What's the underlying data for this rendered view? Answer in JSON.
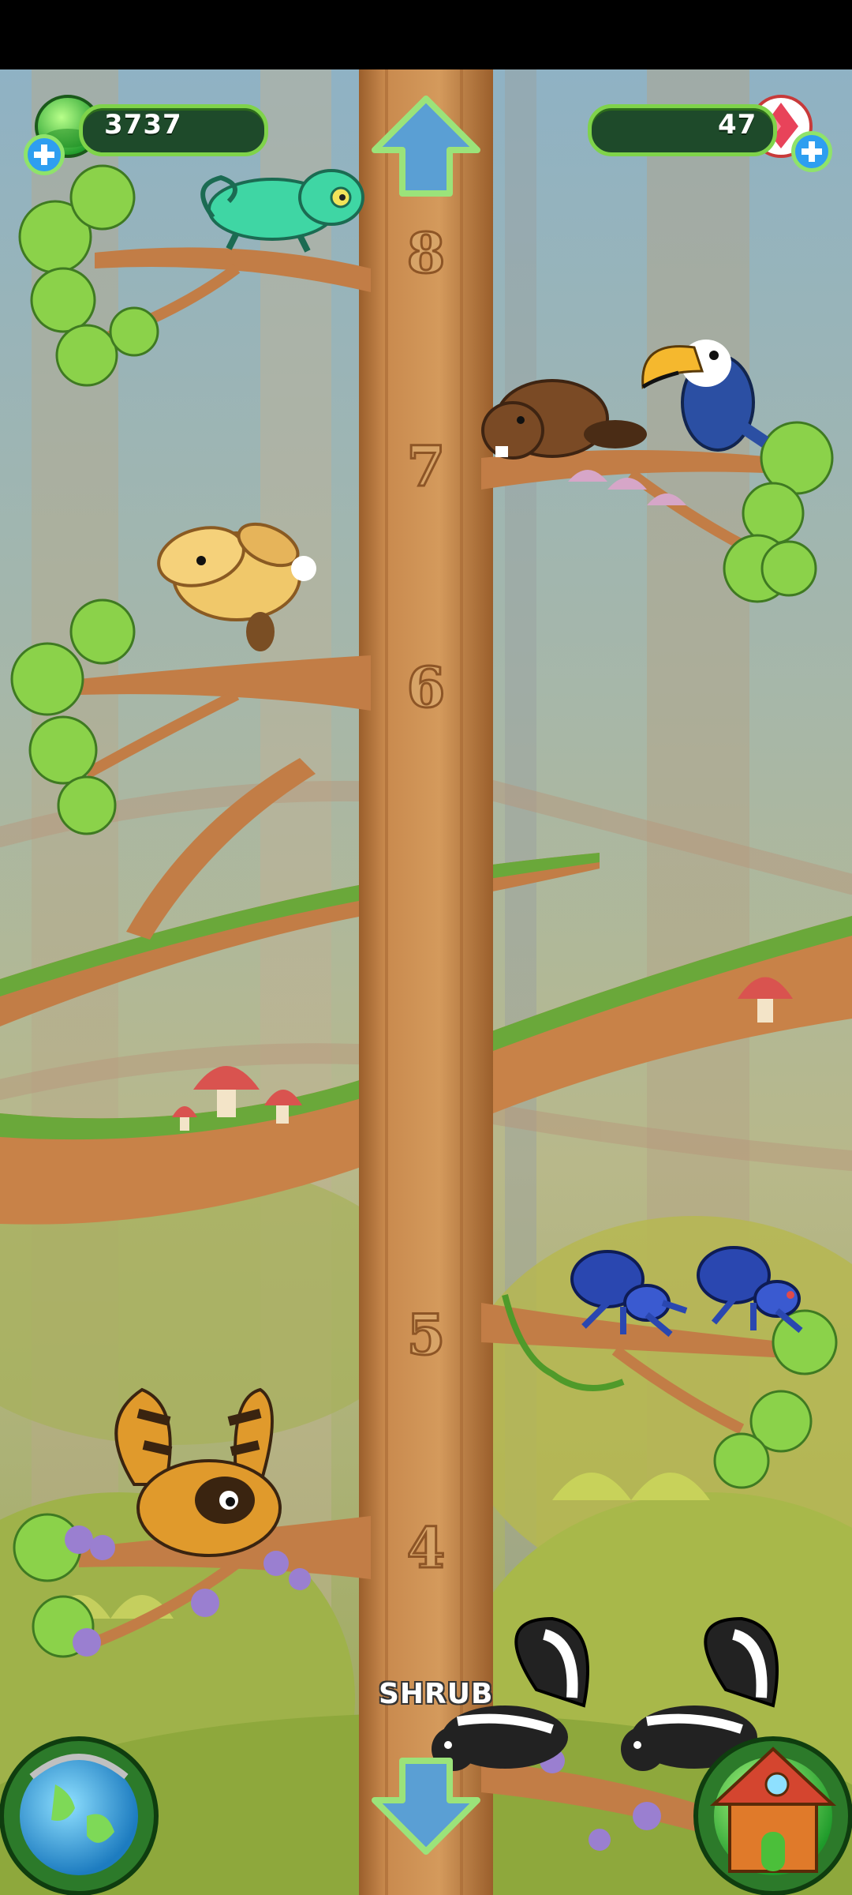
{
  "hud": {
    "currency_amount": "3737",
    "gem_amount": "47",
    "currency_icon": "green-gem-icon",
    "gem_icon": "red-crystal-icon"
  },
  "tree": {
    "level_numbers": [
      "8",
      "7",
      "6",
      "5",
      "4"
    ],
    "current_level_label": "SHRUB"
  },
  "animals": [
    "chameleon",
    "beaver",
    "toucan",
    "lop-rabbit",
    "blue-tarantula",
    "blue-tarantula",
    "red-panda-raccoon",
    "skunk",
    "skunk"
  ],
  "buttons": {
    "up": "arrow-up-icon",
    "down": "arrow-down-icon",
    "world_map": "globe-icon",
    "home": "house-icon"
  },
  "colors": {
    "trunk": "#c98a4e",
    "sky": "#8fb3c6",
    "leaf": "#8bd24a",
    "hud_border": "#7fd34a"
  }
}
